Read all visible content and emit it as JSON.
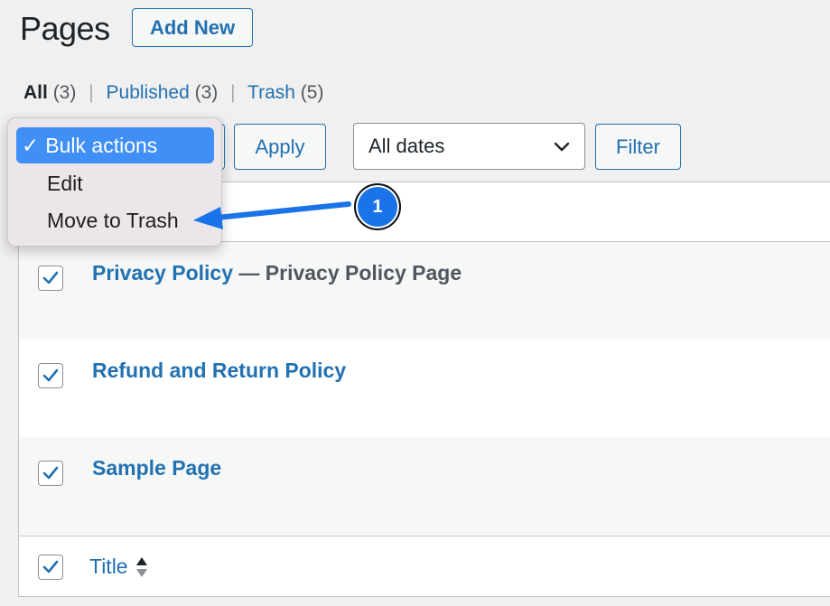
{
  "header": {
    "title": "Pages",
    "add_new_label": "Add New"
  },
  "filters": {
    "all_label": "All",
    "all_count": "(3)",
    "published_label": "Published",
    "published_count": "(3)",
    "trash_label": "Trash",
    "trash_count": "(5)",
    "separator": "|"
  },
  "toolbar": {
    "apply_label": "Apply",
    "date_selected": "All dates",
    "filter_label": "Filter"
  },
  "bulk_dropdown": {
    "check_glyph": "✓",
    "items": [
      {
        "label": "Bulk actions",
        "selected": true
      },
      {
        "label": "Edit",
        "selected": false
      },
      {
        "label": "Move to Trash",
        "selected": false
      }
    ]
  },
  "table": {
    "column_title": "Title",
    "rows": [
      {
        "title": "Privacy Policy",
        "state": " — Privacy Policy Page",
        "checked": true
      },
      {
        "title": "Refund and Return Policy",
        "state": "",
        "checked": true
      },
      {
        "title": "Sample Page",
        "state": "",
        "checked": true
      }
    ],
    "footer_checked": true
  },
  "annotation": {
    "badge_number": "1",
    "color": "#1a73e8"
  },
  "colors": {
    "accent": "#2271b1",
    "dropdown_highlight": "#3f8ff6",
    "background": "#f0f0f1"
  },
  "icons": {
    "checkbox": "checkmark-icon",
    "date_select": "chevron-down-icon",
    "sort": "sort-arrows-icon",
    "annotation_arrow": "arrow-left-icon"
  }
}
